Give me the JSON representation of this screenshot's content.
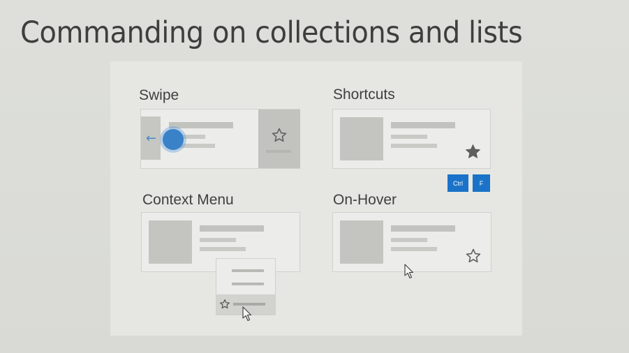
{
  "slide": {
    "title": "Commanding on collections and lists"
  },
  "sections": {
    "swipe": {
      "label": "Swipe",
      "arrow": "←",
      "star_icon": "star-outline-icon"
    },
    "shortcuts": {
      "label": "Shortcuts",
      "star_icon": "star-filled-icon",
      "keys": [
        "Ctrl",
        "F"
      ]
    },
    "context_menu": {
      "label": "Context Menu",
      "star_icon": "star-outline-icon",
      "cursor_icon": "mouse-cursor-icon"
    },
    "on_hover": {
      "label": "On-Hover",
      "star_icon": "star-outline-icon",
      "cursor_icon": "mouse-cursor-icon"
    }
  },
  "colors": {
    "accent": "#1a73c8",
    "touch": "#3a82c8",
    "background": "#dcdcd8",
    "panel": "#e6e7e3",
    "placeholder": "#c4c5c1"
  }
}
